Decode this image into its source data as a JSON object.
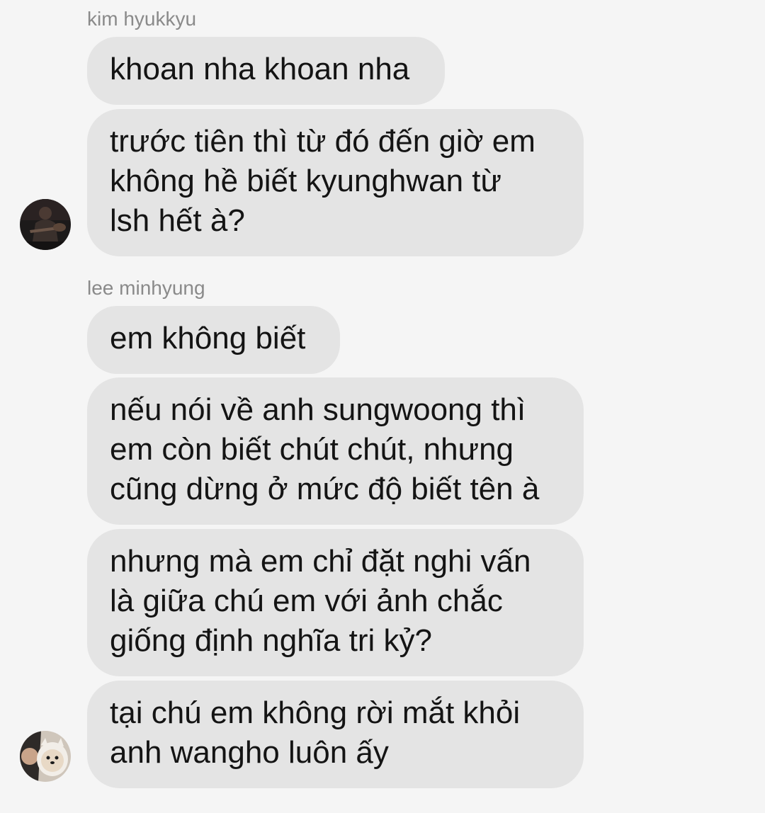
{
  "conversation": {
    "groups": [
      {
        "sender": "kim hyukkyu",
        "avatar_icon": "avatar-guitarist-icon",
        "messages": [
          [
            "khoan nha khoan nha"
          ],
          [
            "trước tiên thì từ đó đến giờ em",
            "không hề biết kyunghwan từ",
            "lsh hết à?"
          ]
        ]
      },
      {
        "sender": "lee minhyung",
        "avatar_icon": "avatar-dog-icon",
        "messages": [
          [
            "em không biết"
          ],
          [
            "nếu nói về anh sungwoong thì",
            "em còn biết chút chút, nhưng",
            "cũng dừng ở mức độ biết tên à"
          ],
          [
            "nhưng mà em chỉ đặt nghi vấn",
            "là giữa chú em với ảnh chắc",
            "giống định nghĩa tri kỷ?"
          ],
          [
            "tại chú em không rời mắt khỏi",
            "anh wangho luôn ấy"
          ]
        ]
      }
    ]
  },
  "colors": {
    "background": "#f5f5f5",
    "bubble": "#e4e4e4",
    "text": "#141414",
    "sender_name": "#8a8a8a"
  }
}
